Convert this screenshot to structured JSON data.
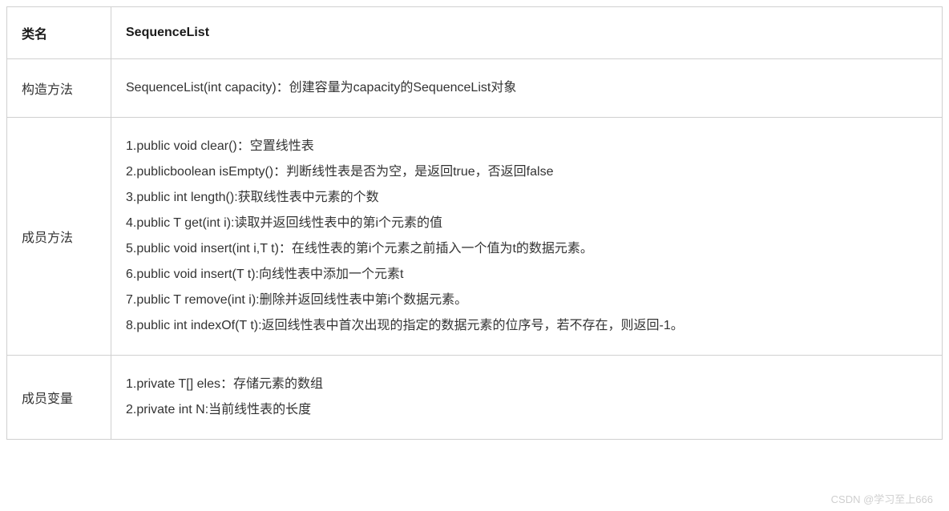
{
  "header": {
    "label": "类名",
    "value": "SequenceList"
  },
  "rows": [
    {
      "label": "构造方法",
      "lines": [
        "SequenceList(int capacity)：创建容量为capacity的SequenceList对象"
      ]
    },
    {
      "label": "成员方法",
      "lines": [
        "1.public void clear()：空置线性表",
        "2.publicboolean isEmpty()：判断线性表是否为空，是返回true，否返回false",
        "3.public int length():获取线性表中元素的个数",
        "4.public T get(int i):读取并返回线性表中的第i个元素的值",
        "5.public void insert(int i,T t)：在线性表的第i个元素之前插入一个值为t的数据元素。",
        "6.public void insert(T t):向线性表中添加一个元素t",
        "7.public T remove(int i):删除并返回线性表中第i个数据元素。",
        "8.public int indexOf(T t):返回线性表中首次出现的指定的数据元素的位序号，若不存在，则返回-1。"
      ]
    },
    {
      "label": "成员变量",
      "lines": [
        "1.private T[] eles：存储元素的数组",
        "2.private int N:当前线性表的长度"
      ]
    }
  ],
  "watermark": "CSDN @学习至上666"
}
